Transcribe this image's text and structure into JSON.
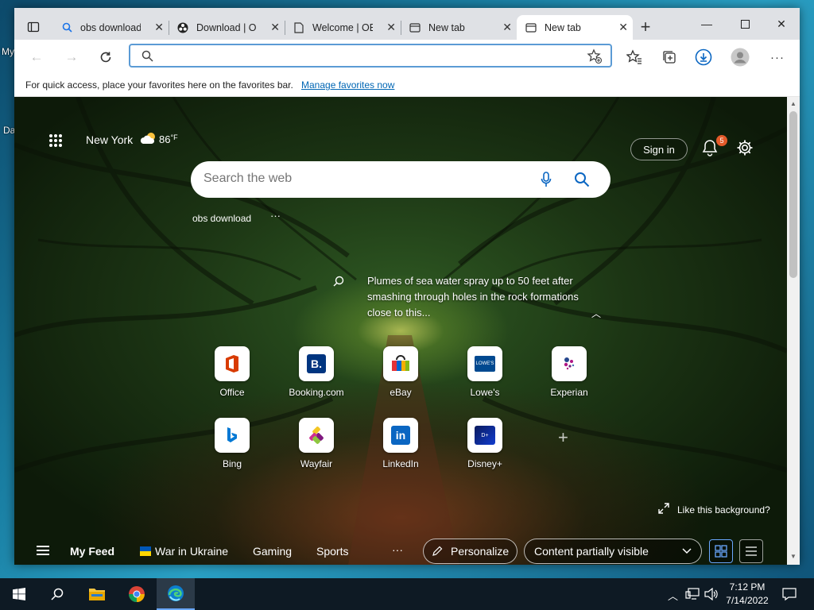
{
  "desktop": {
    "labels": [
      "My",
      "Da"
    ]
  },
  "browser": {
    "tabs": [
      {
        "label": "obs download",
        "icon": "search-icon"
      },
      {
        "label": "Download | OBS",
        "icon": "obs-icon"
      },
      {
        "label": "Welcome | OBS",
        "icon": "page-icon"
      },
      {
        "label": "New tab",
        "icon": "newtab-icon"
      },
      {
        "label": "New tab",
        "icon": "newtab-icon",
        "active": true
      }
    ],
    "address": {
      "value": "",
      "placeholder": ""
    },
    "favorites_bar": {
      "message": "For quick access, place your favorites here on the favorites bar.",
      "link": "Manage favorites now"
    }
  },
  "newtab": {
    "weather": {
      "city": "New York",
      "temp": "86",
      "unit": "°F"
    },
    "search": {
      "placeholder": "Search the web"
    },
    "recent_search": "obs download",
    "more": "···",
    "sign_in": "Sign in",
    "notification_count": "5",
    "caption": "Plumes of sea water spray up to 50 feet after smashing through holes in the rock formations close to this...",
    "quick_links": [
      {
        "label": "Office",
        "color": "#d83b01"
      },
      {
        "label": "Booking.com",
        "color": "#003580"
      },
      {
        "label": "eBay",
        "color": "#e53238"
      },
      {
        "label": "Lowe's",
        "color": "#004990"
      },
      {
        "label": "Experian",
        "color": "#af1685"
      },
      {
        "label": "Bing",
        "color": "#0078d4"
      },
      {
        "label": "Wayfair",
        "color": "#7f187f"
      },
      {
        "label": "LinkedIn",
        "color": "#0a66c2"
      },
      {
        "label": "Disney+",
        "color": "#113ccf"
      }
    ],
    "like_background": "Like this background?",
    "feed_nav": {
      "my_feed": "My Feed",
      "items": [
        "War in Ukraine",
        "Gaming",
        "Sports"
      ],
      "more": "···",
      "personalize": "Personalize",
      "content_visibility": "Content partially visible"
    }
  },
  "taskbar": {
    "time": "7:12 PM",
    "date": "7/14/2022"
  }
}
